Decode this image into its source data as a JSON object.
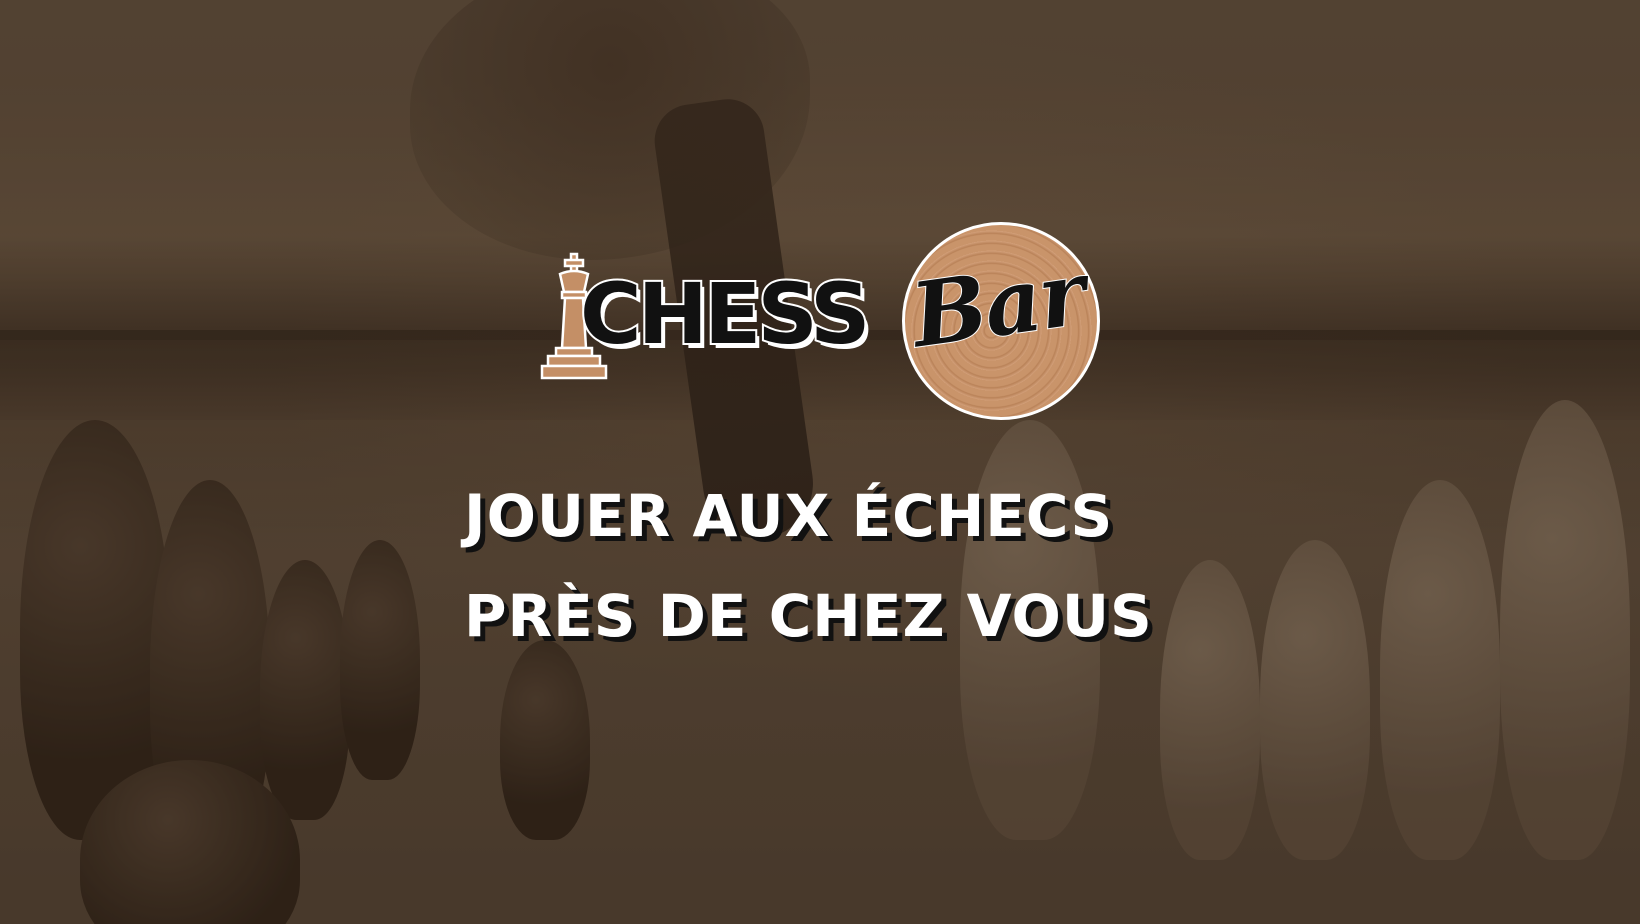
{
  "logo": {
    "word_main": "CHESS",
    "word_script": "Bar",
    "icon": "chess-king-icon"
  },
  "headline": {
    "line1": "JOUER AUX ÉCHECS",
    "line2": "PRÈS DE CHEZ VOUS"
  },
  "colors": {
    "overlay_brown": "#5a4a3a",
    "wood_tan": "#c48f66",
    "text_white": "#ffffff",
    "text_black": "#111111"
  }
}
